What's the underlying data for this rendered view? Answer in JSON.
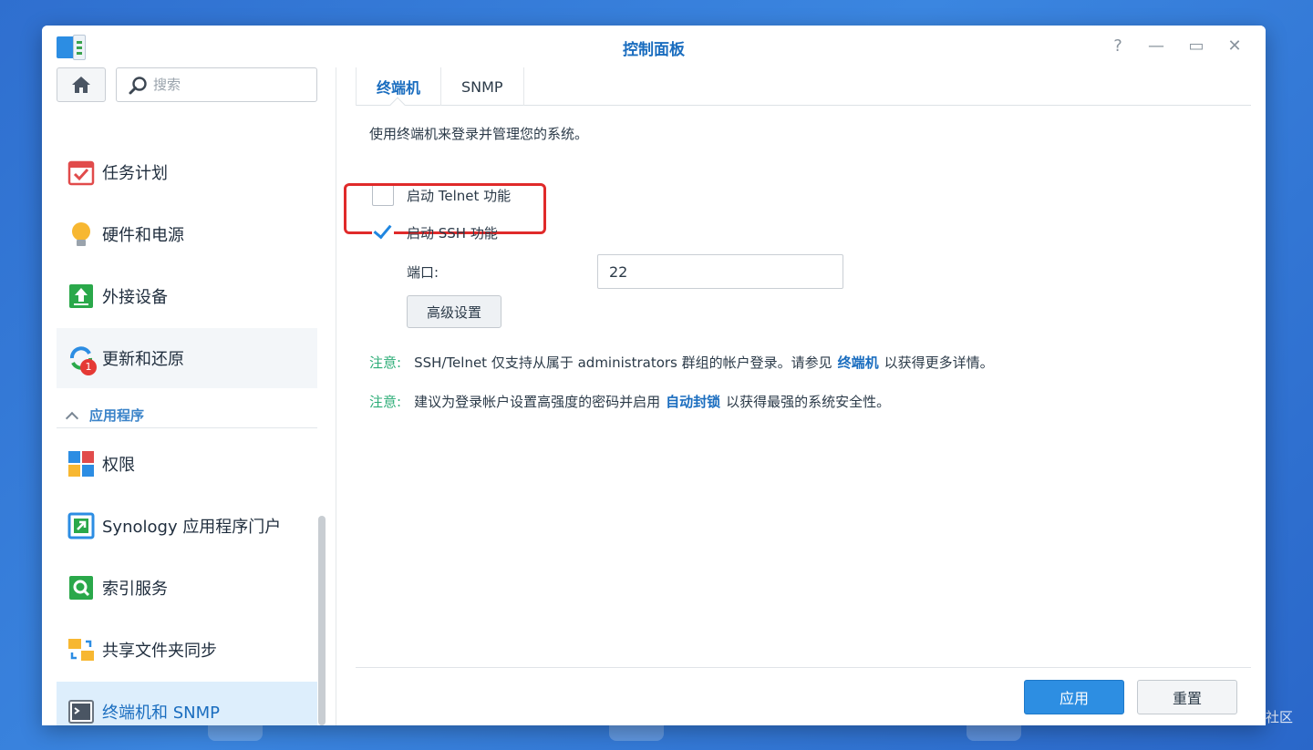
{
  "window": {
    "title": "控制面板",
    "controls": [
      "help-icon",
      "minimize-icon",
      "maximize-icon",
      "close-icon"
    ]
  },
  "search": {
    "placeholder": "搜索"
  },
  "sidebar": {
    "items": [
      {
        "label": "任务计划",
        "icon": "calendar-check-icon"
      },
      {
        "label": "硬件和电源",
        "icon": "lightbulb-icon"
      },
      {
        "label": "外接设备",
        "icon": "external-device-icon"
      },
      {
        "label": "更新和还原",
        "icon": "update-restore-icon",
        "badge": "1"
      }
    ],
    "section": {
      "label": "应用程序"
    },
    "app_items": [
      {
        "label": "权限",
        "icon": "privileges-icon"
      },
      {
        "label": "Synology 应用程序门户",
        "icon": "app-portal-icon"
      },
      {
        "label": "索引服务",
        "icon": "indexing-service-icon"
      },
      {
        "label": "共享文件夹同步",
        "icon": "shared-folder-sync-icon"
      },
      {
        "label": "终端机和 SNMP",
        "icon": "terminal-icon",
        "active": true
      }
    ]
  },
  "tabs": [
    {
      "label": "终端机",
      "active": true
    },
    {
      "label": "SNMP",
      "active": false
    }
  ],
  "terminal": {
    "description": "使用终端机来登录并管理您的系统。",
    "telnet": {
      "label": "启动 Telnet 功能",
      "checked": false
    },
    "ssh": {
      "label": "启动 SSH 功能",
      "checked": true
    },
    "port_label": "端口:",
    "port_value": "22",
    "advanced_button": "高级设置",
    "notes": [
      {
        "label": "注意:",
        "before": "SSH/Telnet 仅支持从属于 administrators 群组的帐户登录。请参见",
        "link": "终端机",
        "after": "以获得更多详情。"
      },
      {
        "label": "注意:",
        "before": "建议为登录帐户设置高强度的密码并启用",
        "link": "自动封锁",
        "after": "以获得最强的系统安全性。"
      }
    ]
  },
  "footer": {
    "apply": "应用",
    "reset": "重置"
  },
  "watermark": "@稀土掘金技术社区",
  "colors": {
    "accent": "#1a6dbf",
    "note_green": "#2bac76",
    "highlight_red": "#e02a2a",
    "apply_blue": "#2d8ee2"
  }
}
